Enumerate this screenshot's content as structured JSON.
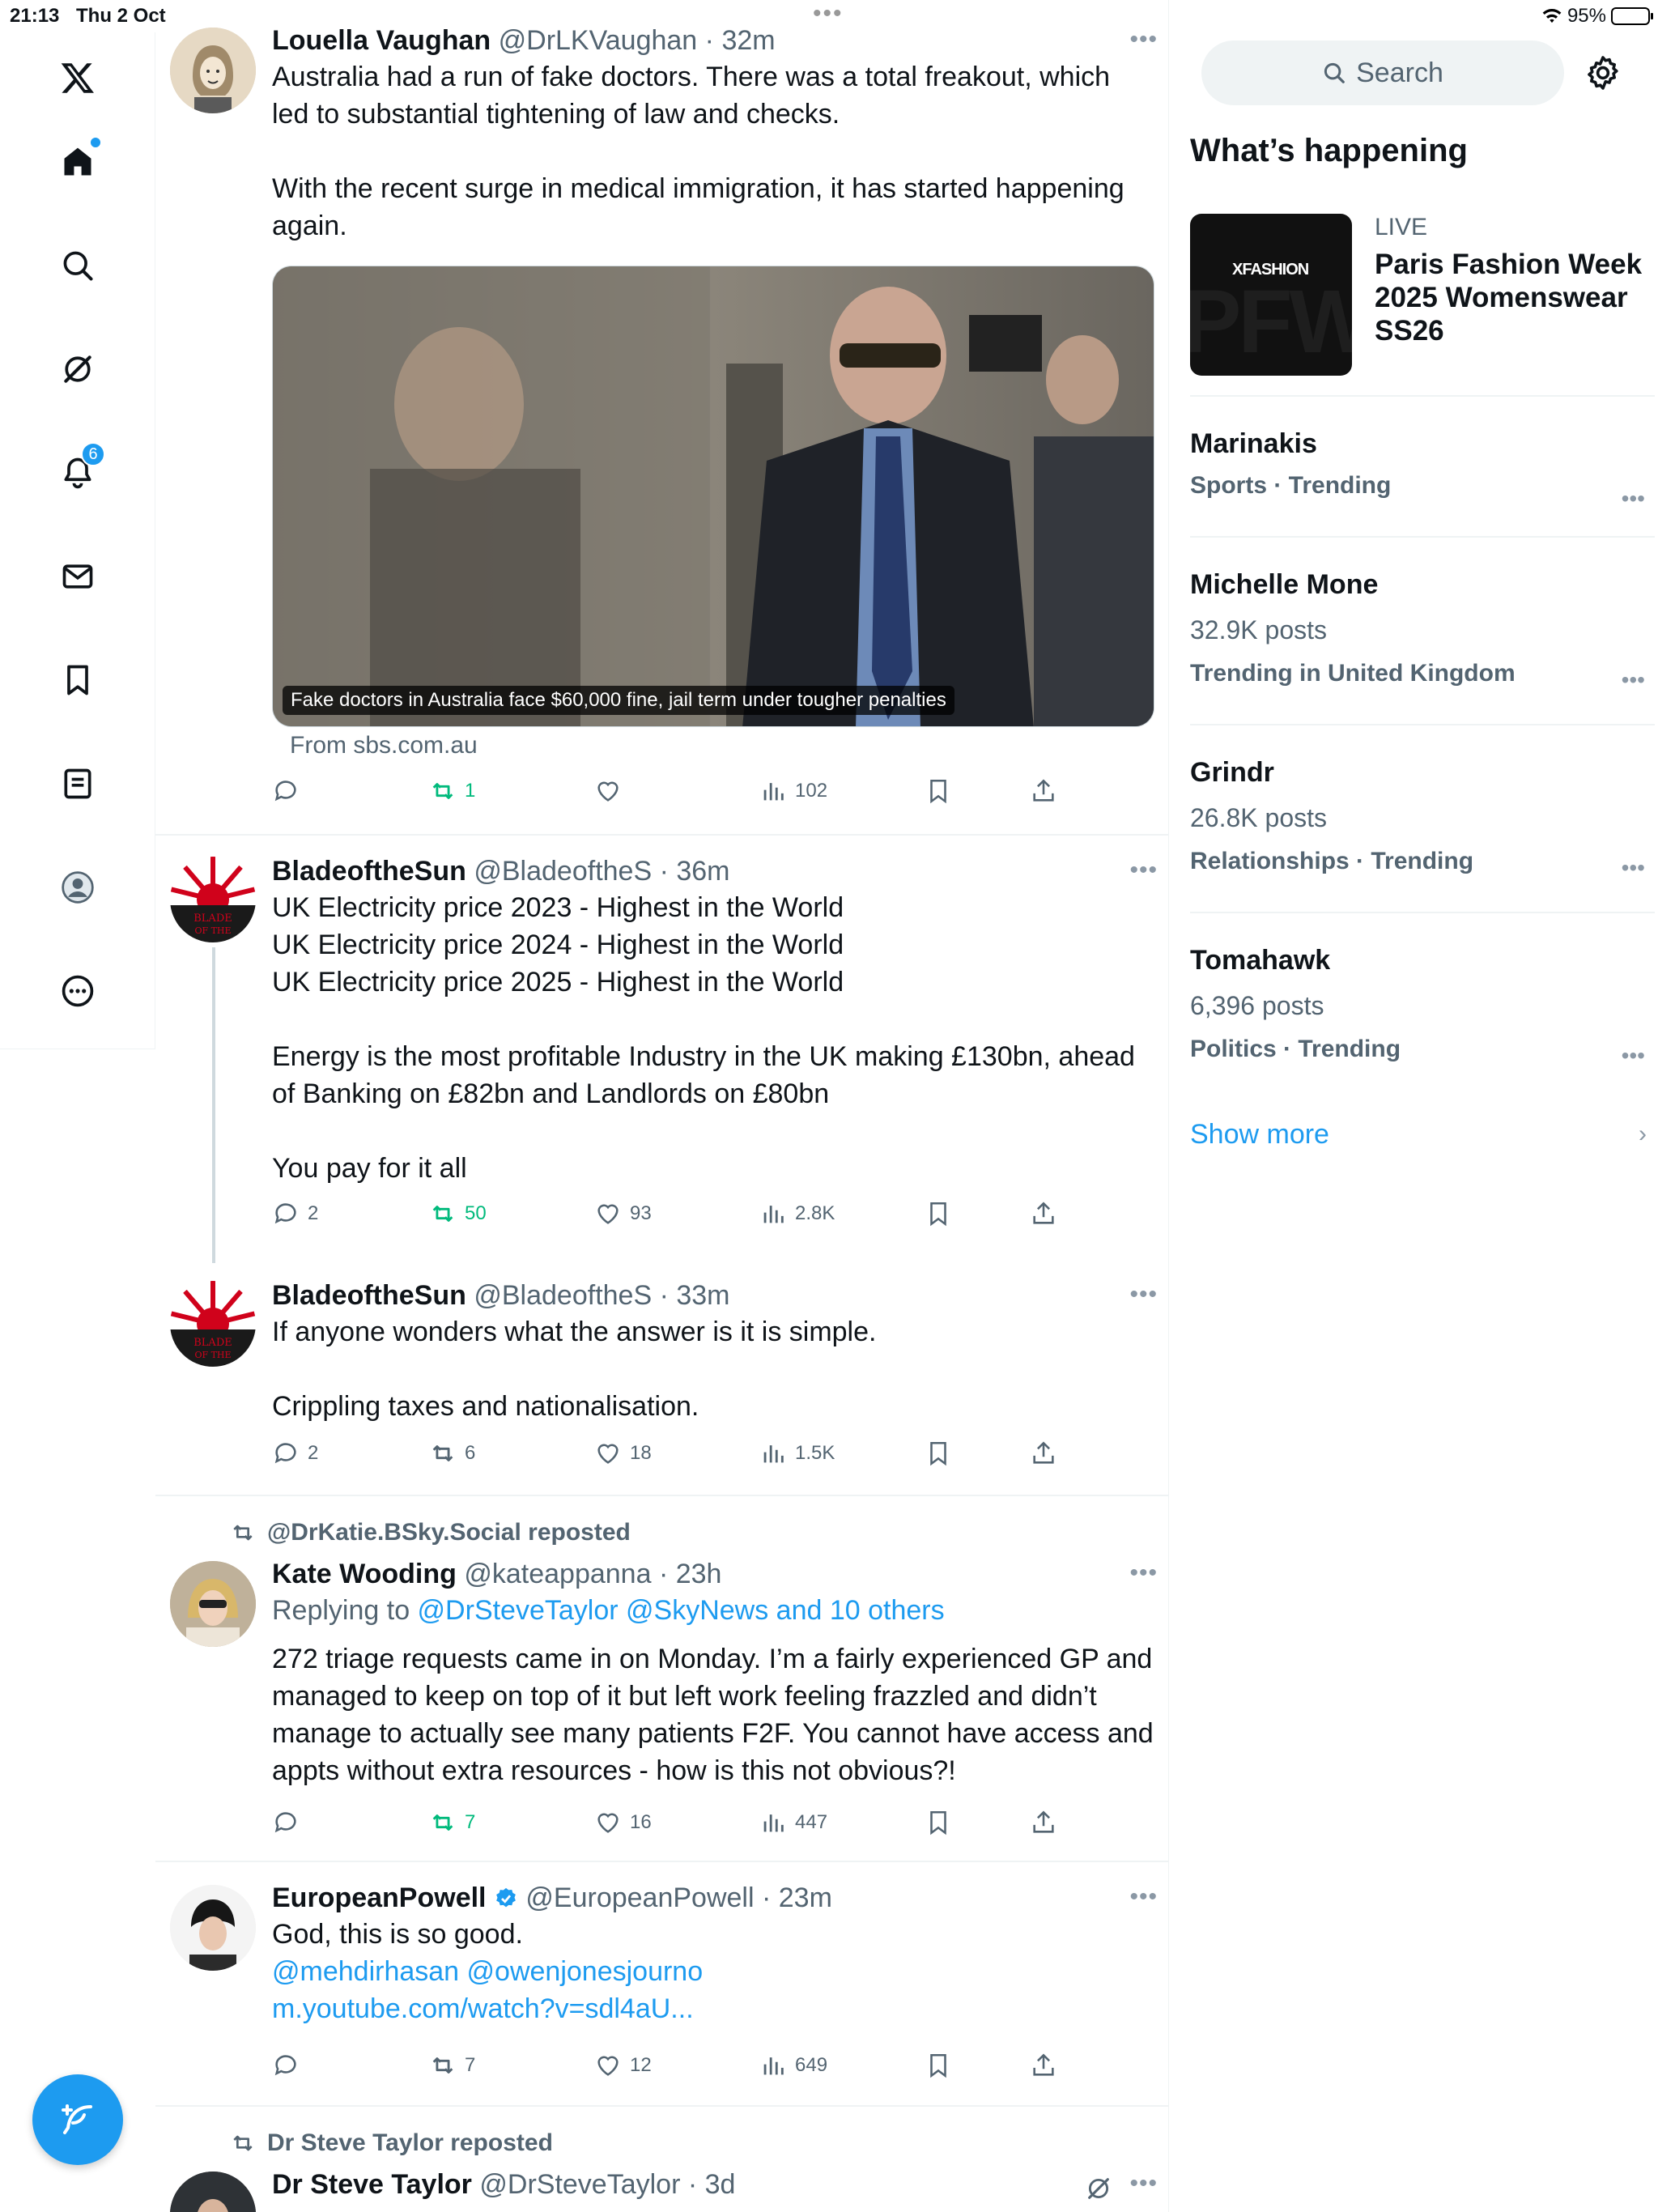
{
  "status_bar": {
    "time": "21:13",
    "date": "Thu 2 Oct",
    "battery": "95%",
    "battery_level": 0.95
  },
  "nav": {
    "notifications_badge": "6",
    "items": [
      "X logo",
      "Home",
      "Search",
      "Grok",
      "Notifications",
      "Messages",
      "Bookmarks",
      "Lists",
      "Profile",
      "More"
    ]
  },
  "posts": [
    {
      "name": "Louella Vaughan",
      "handle": "@DrLKVaughan",
      "time": "· 32m",
      "text": "Australia had a run of fake doctors. There was a total freakout, which\nled to substantial tightening of law and checks.\n\nWith the recent surge in medical immigration, it has started happening\nagain.",
      "card_caption": "Fake doctors in Australia face $60,000 fine, jail term under tougher penalties",
      "card_source": "From sbs.com.au",
      "replies": "",
      "retweets": "1",
      "likes": "",
      "views": "102"
    },
    {
      "name": "BladeoftheSun",
      "handle": "@BladeoftheS",
      "time": "· 36m",
      "text": "UK Electricity price 2023 - Highest in the World\nUK Electricity price 2024 - Highest in the World\nUK Electricity price 2025 - Highest in the World\n\nEnergy is the most profitable Industry in the UK making £130bn, ahead\nof Banking on £82bn and Landlords on £80bn\n\nYou pay for it all",
      "replies": "2",
      "retweets": "50",
      "likes": "93",
      "views": "2.8K"
    },
    {
      "name": "BladeoftheSun",
      "handle": "@BladeoftheS",
      "time": "· 33m",
      "text": "If anyone wonders what the answer is it is simple.\n\nCrippling taxes and nationalisation.",
      "replies": "2",
      "retweets": "6",
      "likes": "18",
      "views": "1.5K"
    },
    {
      "context": "@DrKatie.BSky.Social reposted",
      "name": "Kate Wooding",
      "handle": "@kateappanna",
      "time": "· 23h",
      "reply_prefix": "Replying to ",
      "reply_to": "@DrSteveTaylor @SkyNews and 10 others",
      "text": "272 triage requests came in on Monday. I’m a fairly experienced GP and\nmanaged to keep on top of it but left work feeling frazzled and didn’t\nmanage to actually see many patients F2F. You cannot have access and\nappts without extra resources - how is this not obvious?!",
      "replies": "",
      "retweets": "7",
      "likes": "16",
      "views": "447"
    },
    {
      "name": "EuropeanPowell",
      "handle": "@EuropeanPowell",
      "time": "· 23m",
      "text": "God, this is so good.",
      "mentions": "@mehdirhasan @owenjonesjourno",
      "url": "m.youtube.com/watch?v=sdl4aU...",
      "replies": "",
      "retweets": "7",
      "likes": "12",
      "views": "649"
    },
    {
      "context": "Dr Steve Taylor reposted",
      "name": "Dr Steve Taylor",
      "handle": "@DrSteveTaylor",
      "time": "· 3d"
    }
  ],
  "sidebar": {
    "search_placeholder": "Search",
    "whats_happening": "What’s happening",
    "live": {
      "label": "LIVE",
      "title": "Paris Fashion Week 2025 Womenswear SS26",
      "thumb_brand": "XFASHION",
      "thumb_text": "PFW"
    },
    "trends": [
      {
        "name": "Marinakis",
        "posts": "",
        "category": "Sports · Trending"
      },
      {
        "name": "Michelle Mone",
        "posts": "32.9K posts",
        "category": "Trending in United Kingdom"
      },
      {
        "name": "Grindr",
        "posts": "26.8K posts",
        "category": "Relationships · Trending"
      },
      {
        "name": "Tomahawk",
        "posts": "6,396 posts",
        "category": "Politics · Trending"
      }
    ],
    "show_more": "Show more"
  },
  "colors": {
    "accent": "#1d9bf0",
    "retweet_green": "#00ba7c",
    "muted": "#536471"
  }
}
